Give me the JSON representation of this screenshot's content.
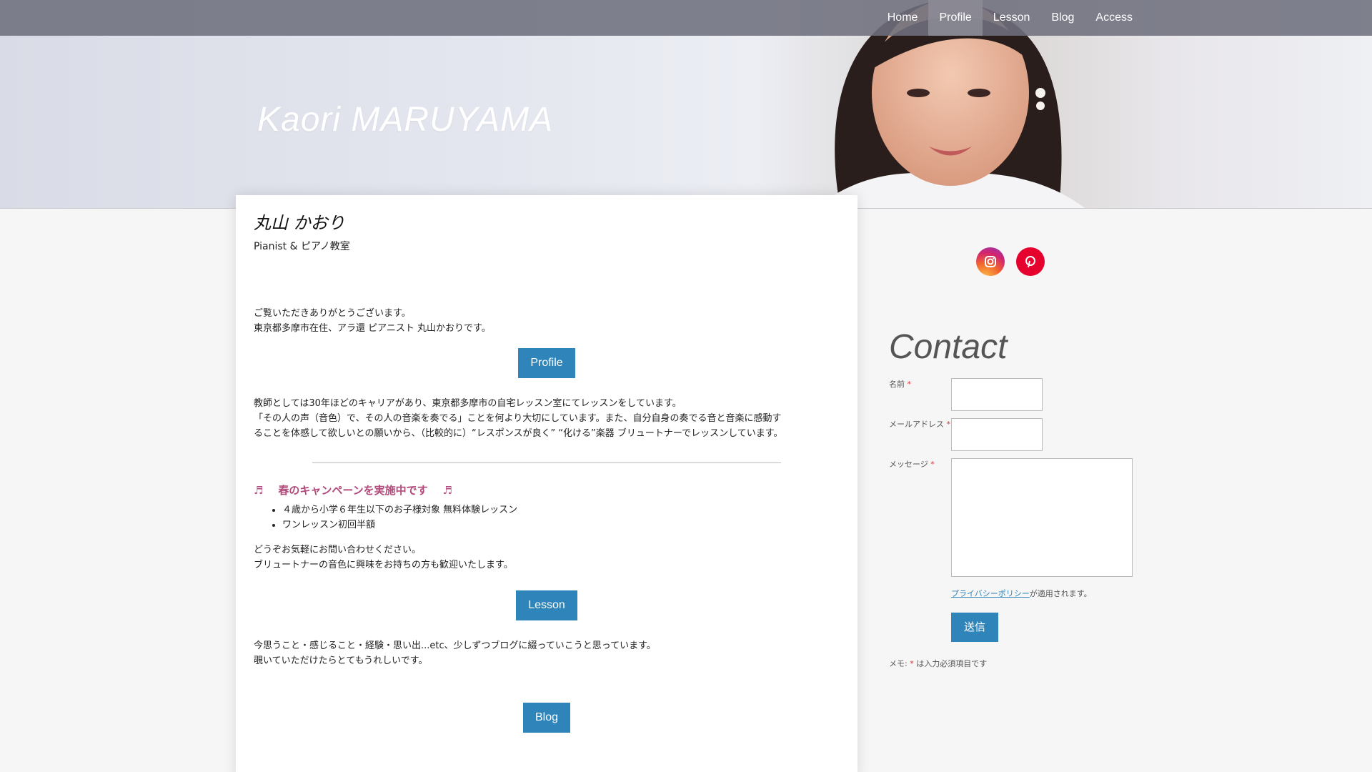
{
  "nav": {
    "items": [
      {
        "label": "Home"
      },
      {
        "label": "Profile"
      },
      {
        "label": "Lesson"
      },
      {
        "label": "Blog"
      },
      {
        "label": "Access"
      }
    ]
  },
  "site_title": "Kaori MARUYAMA",
  "main": {
    "heading": "丸山 かおり",
    "subtitle": "Pianist & ピアノ教室",
    "intro_line1": "ご覧いただきありがとうございます。",
    "intro_line2": "東京都多摩市在住、アラ還 ピアニスト 丸山かおりです。",
    "profile_button": "Profile",
    "teach_line1": "教師としては30年ほどのキャリアがあり、東京都多摩市の自宅レッスン室にてレッスンをしています。",
    "teach_line2": "「その人の声（音色）で、その人の音楽を奏でる」ことを何より大切にしています。また、自分自身の奏でる音と音楽に感動す",
    "teach_line3": "ることを体感して欲しいとの願いから、（比較的に）“レスポンスが良く” “化ける”楽器 ブリュートナーでレッスンしています。",
    "campaign_note_left": "♬",
    "campaign_title": "春のキャンペーンを実施中です",
    "campaign_note_right": "♬",
    "campaign_items": [
      "４歳から小学６年生以下のお子様対象 無料体験レッスン",
      "ワンレッスン初回半額"
    ],
    "inquiry_line1": "どうぞお気軽にお問い合わせください。",
    "inquiry_line2": "ブリュートナーの音色に興味をお持ちの方も歓迎いたします。",
    "lesson_button": "Lesson",
    "blog_line1": "今思うこと・感じること・経験・思い出...etc、少しずつブログに綴っていこうと思っています。",
    "blog_line2": "覗いていただけたらとてもうれしいです。",
    "blog_button": "Blog"
  },
  "sidebar": {
    "social": [
      {
        "icon": "instagram-icon",
        "color": "#d3246f"
      },
      {
        "icon": "pinterest-icon",
        "color": "#e6002d"
      }
    ],
    "contact_title": "Contact",
    "form": {
      "name_label": "名前",
      "email_label": "メールアドレス",
      "message_label": "メッセージ",
      "required_mark": "*",
      "policy_link": "プライバシーポリシー",
      "policy_suffix": "が適用されます。",
      "submit_label": "送信",
      "memo_prefix": "メモ:",
      "memo_suffix": "は入力必須項目です"
    }
  },
  "colors": {
    "accent": "#2f84b9",
    "campaign": "#b04a7a",
    "topbar": "#6e707d"
  }
}
